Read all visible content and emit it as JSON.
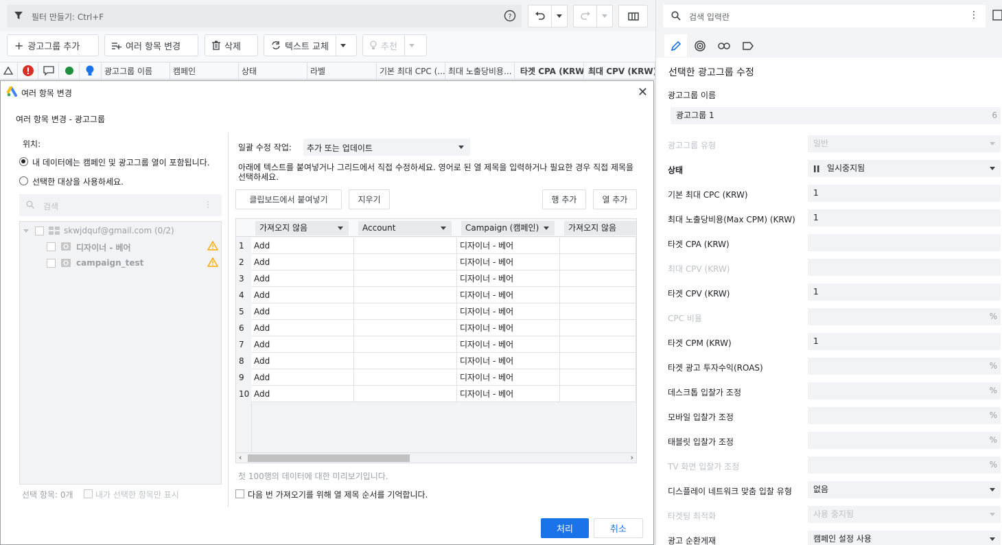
{
  "topbar": {
    "filter_placeholder": "필터 만들기: Ctrl+F"
  },
  "toolbar": {
    "add_adgroup": "광고그룹 추가",
    "multi_change": "여러 항목 변경",
    "delete": "삭제",
    "replace_text": "텍스트 교체",
    "recommend": "추천"
  },
  "columns": [
    "광고그룹 이름",
    "캠페인",
    "상태",
    "라벨",
    "기본 최대 CPC (...",
    "최대 노출당비용...",
    "타겟 CPA (KRW)",
    "최대 CPV (KRW)"
  ],
  "dialog": {
    "title": "여러 항목 변경",
    "subtitle": "여러 항목 변경 - 광고그룹",
    "location_label": "위치:",
    "option1": "내 데이터에는 캠페인 및 광고그룹 열이 포함됩니다.",
    "option2": "선택한 대상을 사용하세요.",
    "search_placeholder": "검색",
    "tree": {
      "account": "skwjdquf@gmail.com (0/2)",
      "campaign1": "디자이너 - 베어",
      "campaign2": "campaign_test"
    },
    "selected_count": "선택 항목: 0개",
    "show_selected_only": "내가 선택한 항목만 표시",
    "bulk_label": "일괄 수정 작업:",
    "bulk_value": "추가 또는 업데이트",
    "instructions": "아래에 텍스트를 붙여넣거나 그리드에서 직접 수정하세요. 영어로 된 열 제목을 입력하거나 필요한 경우 직접 제목을 선택하세요.",
    "paste_button": "클립보드에서 붙여넣기",
    "clear_button": "지우기",
    "add_row_button": "행 추가",
    "add_col_button": "열 추가",
    "grid_headers": [
      "가져오지 않음",
      "Account",
      "Campaign (캠페인)",
      "가져오지 않음"
    ],
    "grid_rows": [
      {
        "num": "1",
        "action": "Add",
        "campaign": "디자이너 - 베어"
      },
      {
        "num": "2",
        "action": "Add",
        "campaign": "디자이너 - 베어"
      },
      {
        "num": "3",
        "action": "Add",
        "campaign": "디자이너 - 베어"
      },
      {
        "num": "4",
        "action": "Add",
        "campaign": "디자이너 - 베어"
      },
      {
        "num": "5",
        "action": "Add",
        "campaign": "디자이너 - 베어"
      },
      {
        "num": "6",
        "action": "Add",
        "campaign": "디자이너 - 베어"
      },
      {
        "num": "7",
        "action": "Add",
        "campaign": "디자이너 - 베어"
      },
      {
        "num": "8",
        "action": "Add",
        "campaign": "디자이너 - 베어"
      },
      {
        "num": "9",
        "action": "Add",
        "campaign": "디자이너 - 베어"
      },
      {
        "num": "10",
        "action": "Add",
        "campaign": "디자이너 - 베어"
      }
    ],
    "preview_note": "첫 100행의 데이터에 대한 미리보기입니다.",
    "remember_label": "다음 번 가져오기를 위해 열 제목 순서를 기억합니다.",
    "process_button": "처리",
    "cancel_button": "취소"
  },
  "panel": {
    "search_placeholder": "검색 입력란",
    "title": "선택한 광고그룹 수정",
    "name_label": "광고그룹 이름",
    "name_value": "광고그룹 1",
    "name_count": "6",
    "fields": [
      {
        "label": "광고그룹 유형",
        "value": "일반",
        "disabled": true,
        "kind": "select"
      },
      {
        "label": "상태",
        "value": "일시중지됨",
        "disabled": false,
        "kind": "select",
        "bold": true
      },
      {
        "label": "기본 최대 CPC (KRW)",
        "value": "1",
        "disabled": false,
        "kind": "text"
      },
      {
        "label": "최대 노출당비용(Max CPM) (KRW)",
        "value": "1",
        "disabled": false,
        "kind": "text"
      },
      {
        "label": "타겟 CPA (KRW)",
        "value": "",
        "disabled": false,
        "kind": "text"
      },
      {
        "label": "최대 CPV (KRW)",
        "value": "",
        "disabled": true,
        "kind": "text"
      },
      {
        "label": "타겟 CPV (KRW)",
        "value": "1",
        "disabled": false,
        "kind": "text"
      },
      {
        "label": "CPC 비율",
        "value": "",
        "disabled": true,
        "kind": "pct"
      },
      {
        "label": "타겟 CPM (KRW)",
        "value": "1",
        "disabled": false,
        "kind": "text"
      },
      {
        "label": "타겟 광고 투자수익(ROAS)",
        "value": "",
        "disabled": false,
        "kind": "pct"
      },
      {
        "label": "데스크톱 입찰가 조정",
        "value": "",
        "disabled": false,
        "kind": "pct"
      },
      {
        "label": "모바일 입찰가 조정",
        "value": "",
        "disabled": false,
        "kind": "pct"
      },
      {
        "label": "태블릿 입찰가 조정",
        "value": "",
        "disabled": false,
        "kind": "pct"
      },
      {
        "label": "TV 화면 입찰가 조정",
        "value": "",
        "disabled": true,
        "kind": "pct"
      },
      {
        "label": "디스플레이 네트워크 맞춤 입찰 유형",
        "value": "없음",
        "disabled": false,
        "kind": "select"
      },
      {
        "label": "타겟팅 최적화",
        "value": "사용 중지됨",
        "disabled": true,
        "kind": "select"
      },
      {
        "label": "광고 순환게재",
        "value": "캠페인 설정 사용",
        "disabled": false,
        "kind": "select"
      }
    ],
    "pct_symbol": "%"
  },
  "colors": {
    "accent": "#1a73e8",
    "error": "#d93025",
    "ok": "#1e8e3e",
    "warn": "#f9ab00"
  }
}
